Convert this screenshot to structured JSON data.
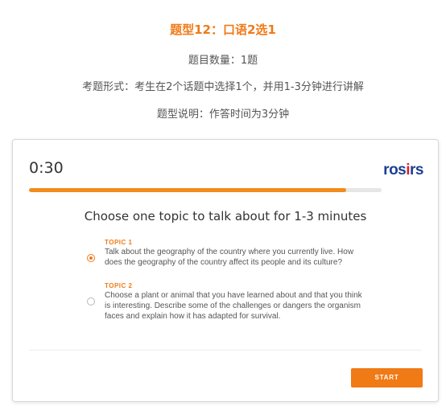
{
  "intro": {
    "title": "题型12：口语2选1",
    "question_count": "题目数量：1题",
    "format": "考题形式：考生在2个话题中选择1个，并用1-3分钟进行讲解",
    "description": "题型说明：作答时间为3分钟"
  },
  "card": {
    "timer": "0:30",
    "brand": {
      "part1": "ros",
      "part2": "i",
      "part3": "rs"
    },
    "progress_fraction": 0.9,
    "question": "Choose one topic to talk about for 1-3 minutes",
    "topics": [
      {
        "label": "TOPIC 1",
        "text": "Talk about the geography of the country where you currently live. How does the geography of the country affect its people and its culture?",
        "selected": true
      },
      {
        "label": "TOPIC 2",
        "text": "Choose a plant or animal that you have learned about and that you think is interesting. Describe some of the challenges or dangers the organism faces and explain how it has adapted for survival.",
        "selected": false
      }
    ],
    "start_label": "START"
  },
  "colors": {
    "accent": "#f07a16",
    "brand_blue": "#1c3f94",
    "brand_red": "#d6232a"
  }
}
